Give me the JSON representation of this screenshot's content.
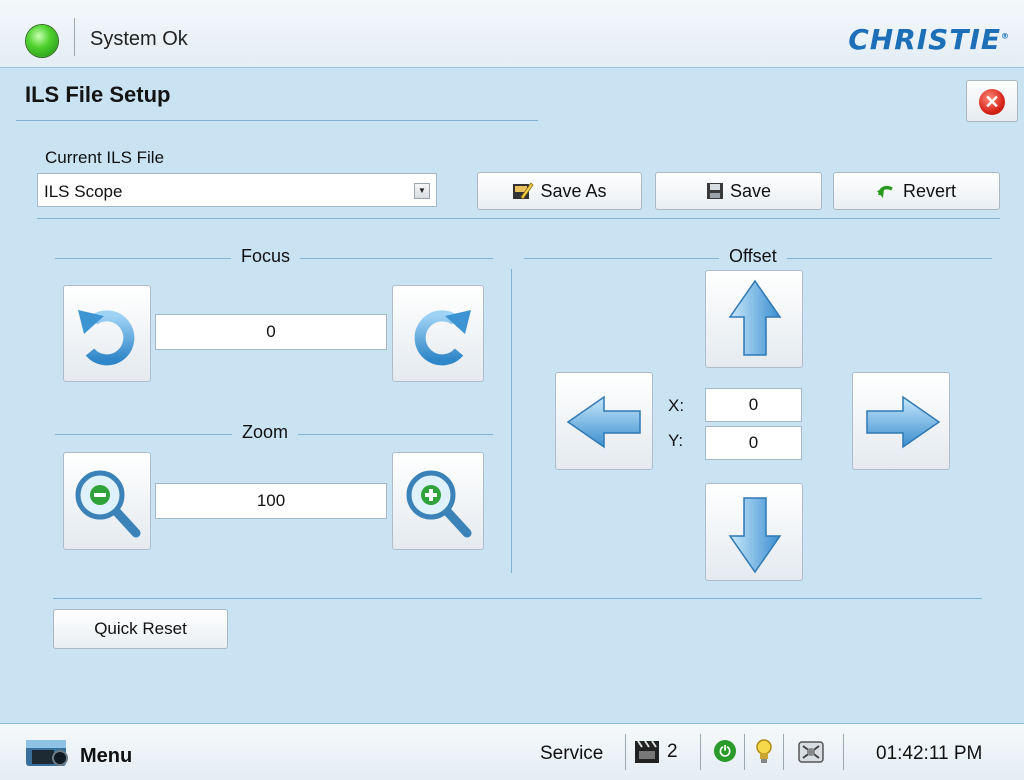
{
  "header": {
    "status_text": "System Ok",
    "brand": "CHRISTIE"
  },
  "page": {
    "title": "ILS File Setup"
  },
  "file": {
    "label": "Current ILS File",
    "selected": "ILS Scope",
    "save_as_label": "Save As",
    "save_label": "Save",
    "revert_label": "Revert"
  },
  "focus": {
    "label": "Focus",
    "value": "0"
  },
  "zoom": {
    "label": "Zoom",
    "value": "100"
  },
  "offset": {
    "label": "Offset",
    "x_label": "X:",
    "y_label": "Y:",
    "x_value": "0",
    "y_value": "0"
  },
  "quick_reset_label": "Quick Reset",
  "footer": {
    "menu_label": "Menu",
    "service_label": "Service",
    "channel_number": "2",
    "time": "01:42:11 PM"
  },
  "colors": {
    "accent": "#1d6fb8",
    "status_ok": "#3fc21f",
    "panel_bg": "#c9e3f3"
  }
}
